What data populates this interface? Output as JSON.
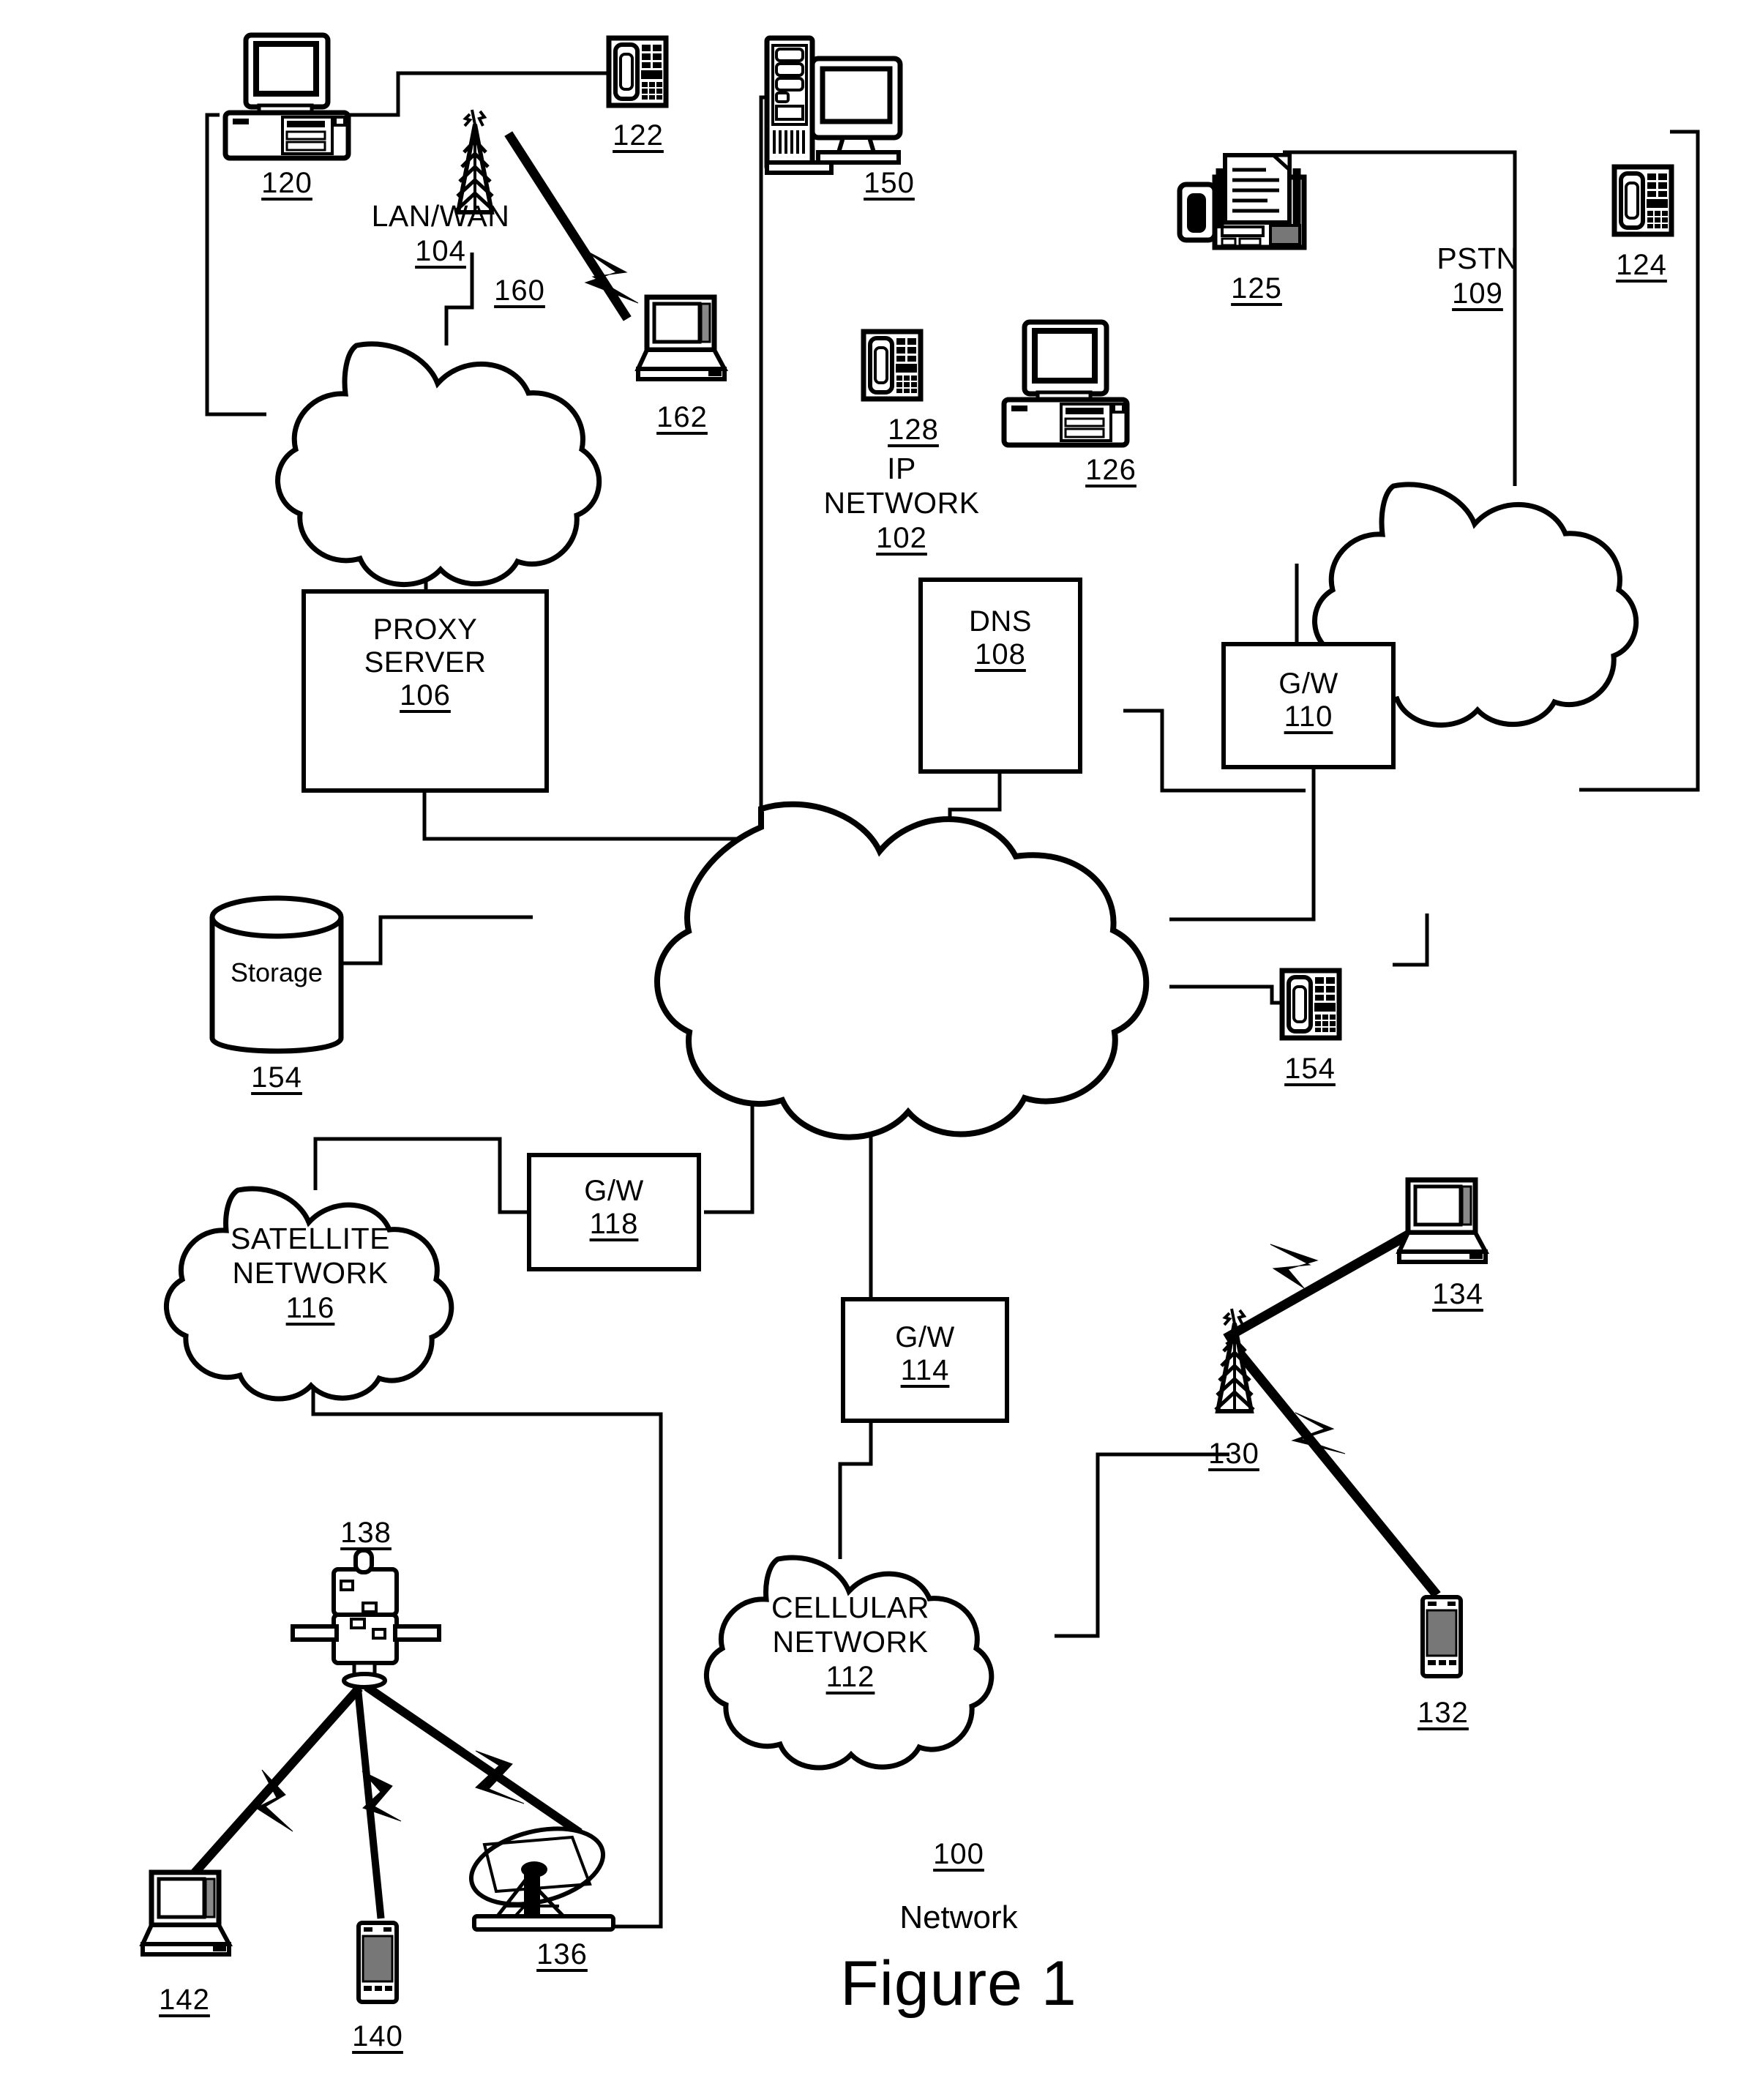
{
  "figure": {
    "title": "Figure 1",
    "system_label": "Network",
    "system_ref": "100"
  },
  "clouds": [
    {
      "id": "lanwan",
      "name": "LAN/WAN",
      "line1": "LAN/WAN",
      "line2": "",
      "ref": "104"
    },
    {
      "id": "pstn",
      "name": "PSTN",
      "line1": "PSTN",
      "line2": "",
      "ref": "109"
    },
    {
      "id": "ipnet",
      "name": "IP NETWORK",
      "line1": "IP",
      "line2": "NETWORK",
      "ref": "102"
    },
    {
      "id": "satnet",
      "name": "SATELLITE NETWORK",
      "line1": "SATELLITE",
      "line2": "NETWORK",
      "ref": "116"
    },
    {
      "id": "cellnet",
      "name": "CELLULAR NETWORK",
      "line1": "CELLULAR",
      "line2": "NETWORK",
      "ref": "112"
    }
  ],
  "boxes": [
    {
      "id": "proxy",
      "line1": "PROXY",
      "line2": "SERVER",
      "ref": "106"
    },
    {
      "id": "dns",
      "line1": "DNS",
      "line2": "",
      "ref": "108"
    },
    {
      "id": "gw110",
      "line1": "G/W",
      "line2": "",
      "ref": "110"
    },
    {
      "id": "gw118",
      "line1": "G/W",
      "line2": "",
      "ref": "118"
    },
    {
      "id": "gw114",
      "line1": "G/W",
      "line2": "",
      "ref": "114"
    }
  ],
  "storage": {
    "label": "Storage",
    "ref": "154"
  },
  "devices": [
    {
      "id": "desktop-120",
      "icon": "desktop-computer-icon",
      "ref": "120"
    },
    {
      "id": "desk-phone-122",
      "icon": "desk-phone-icon",
      "ref": "122"
    },
    {
      "id": "tower-160",
      "icon": "radio-tower-icon",
      "ref": "160"
    },
    {
      "id": "laptop-162",
      "icon": "laptop-icon",
      "ref": "162"
    },
    {
      "id": "tower-server-150",
      "icon": "server-workstation-icon",
      "ref": "150"
    },
    {
      "id": "fax-125",
      "icon": "fax-machine-icon",
      "ref": "125"
    },
    {
      "id": "desk-phone-124",
      "icon": "desk-phone-icon",
      "ref": "124"
    },
    {
      "id": "desk-phone-128",
      "icon": "desk-phone-icon",
      "ref": "128"
    },
    {
      "id": "desktop-126",
      "icon": "desktop-computer-icon",
      "ref": "126"
    },
    {
      "id": "ip-phone-154",
      "icon": "desk-phone-icon",
      "ref": "154"
    },
    {
      "id": "tower-130",
      "icon": "radio-tower-icon",
      "ref": "130"
    },
    {
      "id": "laptop-134",
      "icon": "laptop-icon",
      "ref": "134"
    },
    {
      "id": "mobile-132",
      "icon": "mobile-handset-icon",
      "ref": "132"
    },
    {
      "id": "satellite-138",
      "icon": "satellite-icon",
      "ref": "138"
    },
    {
      "id": "laptop-142",
      "icon": "laptop-icon",
      "ref": "142"
    },
    {
      "id": "mobile-140",
      "icon": "mobile-handset-icon",
      "ref": "140"
    },
    {
      "id": "satellite-dish-136",
      "icon": "satellite-dish-icon",
      "ref": "136"
    }
  ],
  "colors": {
    "ink": "#000000",
    "paper": "#ffffff"
  }
}
